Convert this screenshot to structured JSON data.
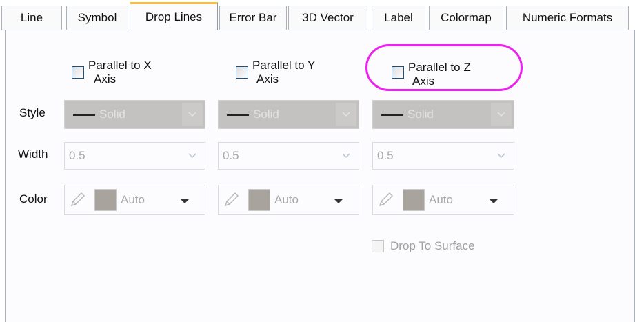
{
  "tabs": [
    {
      "label": "Line",
      "active": false
    },
    {
      "label": "Symbol",
      "active": false
    },
    {
      "label": "Drop Lines",
      "active": true
    },
    {
      "label": "Error Bar",
      "active": false
    },
    {
      "label": "3D Vector",
      "active": false
    },
    {
      "label": "Label",
      "active": false
    },
    {
      "label": "Colormap",
      "active": false
    },
    {
      "label": "Numeric Formats",
      "active": false
    }
  ],
  "checkboxes": {
    "x": {
      "line1": "Parallel to X",
      "line2": "Axis",
      "checked": false
    },
    "y": {
      "line1": "Parallel to Y",
      "line2": "Axis",
      "checked": false
    },
    "z": {
      "line1": "Parallel to Z",
      "line2": "Axis",
      "checked": false
    }
  },
  "labels": {
    "style": "Style",
    "width": "Width",
    "color": "Color"
  },
  "columns": [
    {
      "style": "Solid",
      "width": "0.5",
      "color": "Auto"
    },
    {
      "style": "Solid",
      "width": "0.5",
      "color": "Auto"
    },
    {
      "style": "Solid",
      "width": "0.5",
      "color": "Auto"
    }
  ],
  "drop_to_surface": {
    "label": "Drop To Surface",
    "checked": false,
    "enabled": false
  },
  "colors": {
    "highlight": "#ee22ee",
    "active_tab_accent": "#ffbf3d",
    "swatch": "#a8a39c"
  },
  "icons": [
    "pen-icon",
    "chevron-down-icon",
    "dropdown-arrow-icon"
  ]
}
